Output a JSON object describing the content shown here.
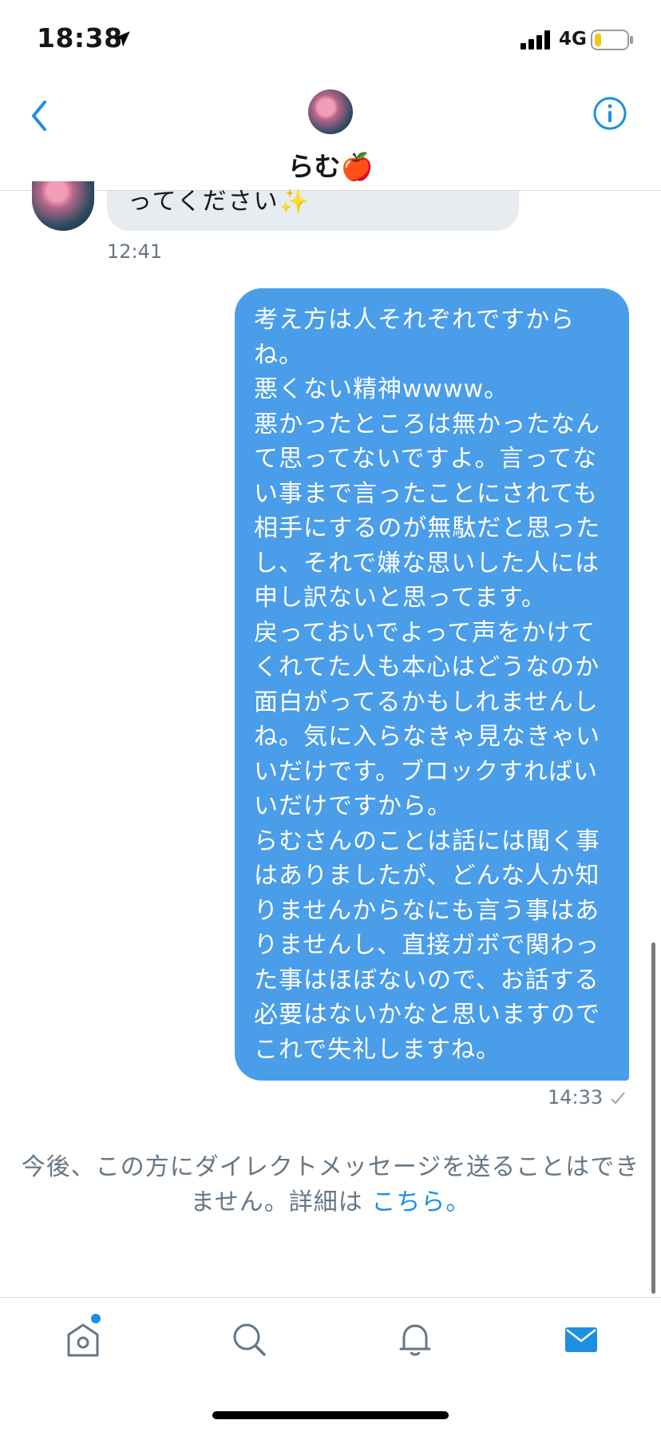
{
  "status_bar": {
    "time": "18:38",
    "network": "4G"
  },
  "header": {
    "title": "らむ🍎"
  },
  "conversation": {
    "received": {
      "text": "ってください✨",
      "time": "12:41"
    },
    "sent": {
      "text": "考え方は人それぞれですから\nね。\n悪くない精神wwww。\n悪かったところは無かったなん\nて思ってないですよ。言ってな\nい事まで言ったことにされても\n相手にするのが無駄だと思った\nし、それで嫌な思いした人には\n申し訳ないと思ってます。\n戻っておいでよって声をかけて\nくれてた人も本心はどうなのか\n面白がってるかもしれませんし\nね。気に入らなきゃ見なきゃい\nいだけです。ブロックすればい\nいだけですから。\nらむさんのことは話には聞く事\nはありましたが、どんな人か知\nりませんからなにも言う事はあ\nりませんし、直接ガボで関わっ\nた事はほぼないので、お話する\n必要はないかなと思いますので\nこれで失礼しますね。",
      "time": "14:33"
    }
  },
  "notice": {
    "line1": "今後、この方にダイレクトメッセージを送ることはでき",
    "line2": "ません。詳細は",
    "link": "こちら。"
  },
  "tabs": [
    {
      "name": "home",
      "icon": "home-icon"
    },
    {
      "name": "search",
      "icon": "search-icon"
    },
    {
      "name": "notifications",
      "icon": "bell-icon"
    },
    {
      "name": "messages",
      "icon": "mail-icon"
    }
  ],
  "colors": {
    "accent": "#1d8fe0",
    "sent_bubble": "#4a9de8",
    "received_bubble": "#e6ecf0",
    "muted": "#657786"
  }
}
